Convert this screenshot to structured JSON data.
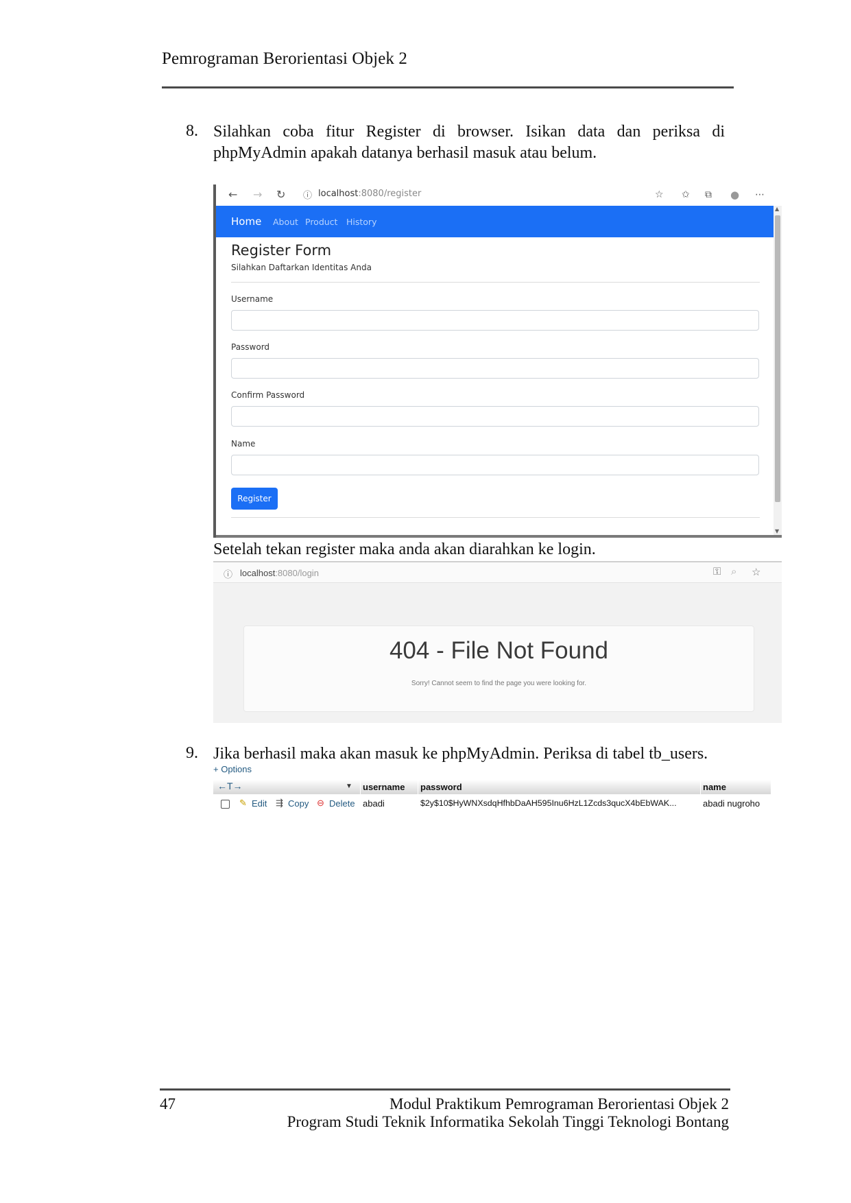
{
  "header": {
    "title": "Pemrograman Berorientasi Objek 2"
  },
  "steps": [
    {
      "number": "8.",
      "text_line1": "Silahkan coba fitur Register di browser. Isikan data dan periksa di",
      "text_line2": "phpMyAdmin apakah datanya berhasil masuk atau belum."
    },
    {
      "number": "9.",
      "text": "Jika berhasil maka akan masuk ke phpMyAdmin. Periksa di tabel tb_users."
    }
  ],
  "between_text": "Setelah tekan register maka anda akan diarahkan ke login.",
  "register_screenshot": {
    "url_host": "localhost",
    "url_rest": ":8080/register",
    "nav": {
      "home": "Home",
      "links": [
        "About",
        "Product",
        "History"
      ]
    },
    "form_title": "Register Form",
    "form_subtitle": "Silahkan Daftarkan Identitas Anda",
    "fields": [
      "Username",
      "Password",
      "Confirm Password",
      "Name"
    ],
    "button": "Register"
  },
  "login_screenshot": {
    "url_host": "localhost",
    "url_rest": ":8080/login",
    "error_title": "404 - File Not Found",
    "error_text": "Sorry! Cannot seem to find the page you were looking for."
  },
  "pma": {
    "options_label": "+ Options",
    "arrows": "←T→",
    "columns": [
      "username",
      "password",
      "name"
    ],
    "row": {
      "actions": [
        "Edit",
        "Copy",
        "Delete"
      ],
      "username": "abadi",
      "password": "$2y$10$HyWNXsdqHfhbDaAH595Inu6HzL1Zcds3qucX4bEbWAK...",
      "name": "abadi nugroho"
    }
  },
  "footer": {
    "page_number": "47",
    "line1": "Modul Praktikum Pemrograman Berorientasi Objek 2",
    "line2": "Program Studi Teknik Informatika Sekolah Tinggi Teknologi Bontang"
  }
}
